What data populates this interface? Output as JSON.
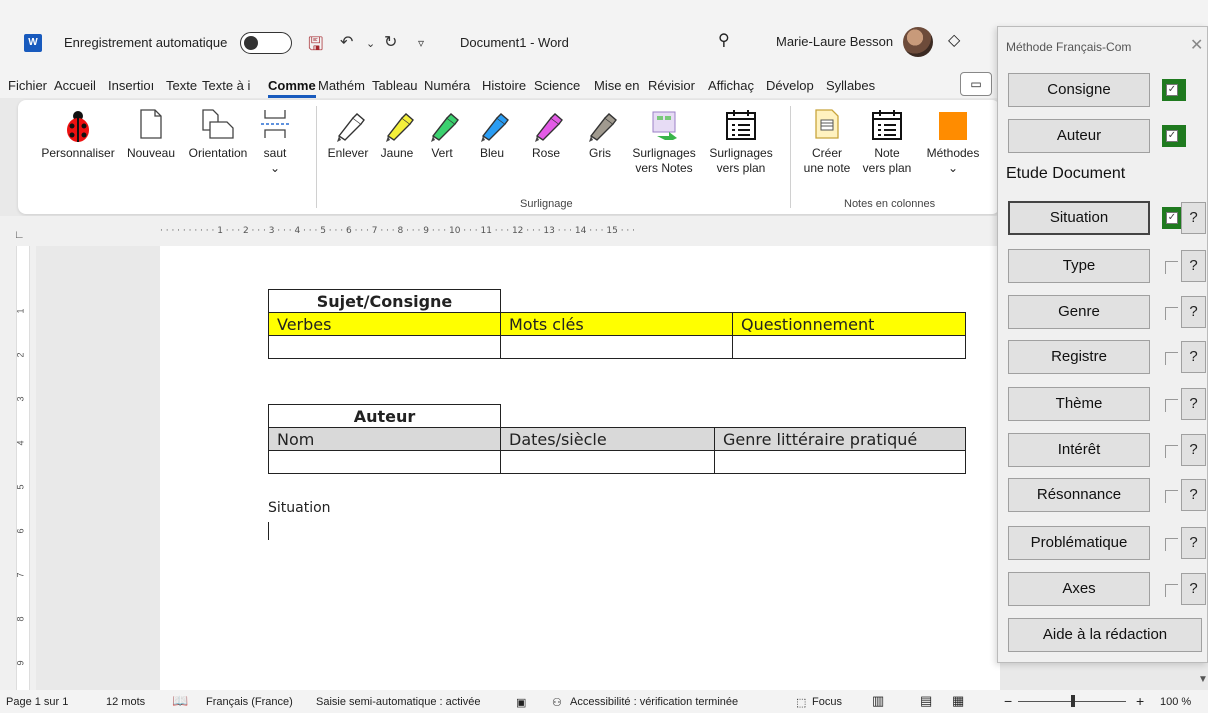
{
  "titlebar": {
    "app_icon": "W",
    "autosave_label": "Enregistrement automatique",
    "document_title": "Document1  -  Word",
    "user_name": "Marie-Laure Besson"
  },
  "menu": {
    "tabs": [
      "Fichier",
      "Accueil",
      "Insertioı",
      "Texte",
      "Texte à i",
      "Comme",
      "Mathém",
      "Tableau",
      "Numéra",
      "Histoire",
      "Science",
      "Mise en",
      "Révisior",
      "Affichaç",
      "Dévelop",
      "Syllabes"
    ],
    "active_tab": "Comme"
  },
  "ribbon": {
    "buttons": {
      "personnaliser": "Personnaliser",
      "nouveau": "Nouveau",
      "orientation": "Orientation",
      "saut": "saut",
      "enlever": "Enlever",
      "jaune": "Jaune",
      "vert": "Vert",
      "bleu": "Bleu",
      "rose": "Rose",
      "gris": "Gris",
      "surl_notes_1": "Surlignages",
      "surl_notes_2": "vers Notes",
      "surl_plan_1": "Surlignages",
      "surl_plan_2": "vers plan",
      "creer_1": "Créer",
      "creer_2": "une note",
      "note_plan_1": "Note",
      "note_plan_2": "vers plan",
      "methodes": "Méthodes"
    },
    "groups": {
      "surlignage": "Surlignage",
      "notes_colonnes": "Notes en colonnes"
    },
    "marker_colors": {
      "enlever": "#ffffff",
      "jaune": "#f4f03a",
      "vert": "#3bd16f",
      "bleu": "#2a9df4",
      "rose": "#e35be6",
      "gris": "#a09a8f"
    }
  },
  "ruler": {
    "text": "· · · · · · · · · · 1 · · · 2 · · · 3 · · · 4 · · · 5 · · · 6 · · · 7 · · · 8 · · · 9 · · · 10 · · · 11 · · · 12 · · · 13 · · · 14 · · · 15 · · ·",
    "vertical_numbers": [
      "1",
      "2",
      "3",
      "4",
      "5",
      "6",
      "7",
      "8",
      "9"
    ]
  },
  "document": {
    "table1": {
      "title": "Sujet/Consigne",
      "headers": [
        "Verbes",
        "Mots clés",
        "Questionnement"
      ],
      "header_bg": "#ffff00"
    },
    "table2": {
      "title": "Auteur",
      "headers": [
        "Nom",
        "Dates/siècle",
        "Genre littéraire pratiqué"
      ],
      "header_bg": "#d9d9d9"
    },
    "situation_label": "Situation"
  },
  "statusbar": {
    "page": "Page 1 sur 1",
    "words": "12 mots",
    "language": "Français (France)",
    "autocomplete": "Saisie semi-automatique : activée",
    "accessibility": "Accessibilité : vérification terminée",
    "focus": "Focus",
    "zoom_minus": "−",
    "zoom_plus": "+",
    "zoom_level": "100 %"
  },
  "panel": {
    "title": "Méthode Français-Com",
    "section_label": "Etude Document",
    "buttons": {
      "consigne": "Consigne",
      "auteur": "Auteur",
      "situation": "Situation",
      "type": "Type",
      "genre": "Genre",
      "registre": "Registre",
      "theme": "Thème",
      "interet": "Intérêt",
      "resonnance": "Résonnance",
      "problematique": "Problématique",
      "axes": "Axes",
      "aide": "Aide à la rédaction"
    },
    "help_label": "?",
    "check_mark": "✓",
    "accent_green": "#1f7a1f"
  }
}
